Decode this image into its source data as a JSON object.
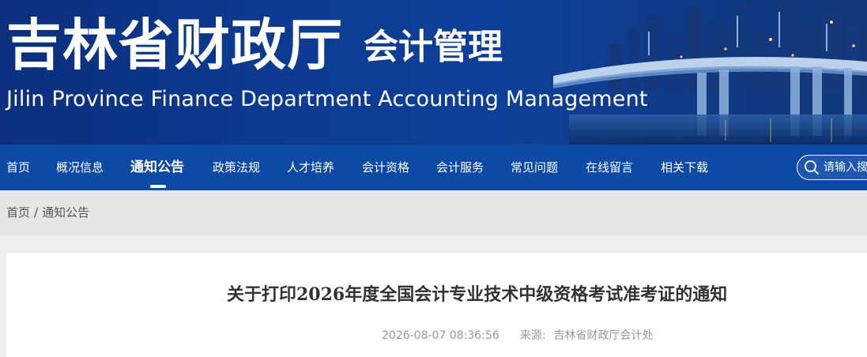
{
  "banner": {
    "title": "吉林省财政厅",
    "subtitle": "会计管理",
    "english": "Jilin Province Finance Department Accounting Management"
  },
  "nav": {
    "items": [
      {
        "label": "首页",
        "active": false
      },
      {
        "label": "概况信息",
        "active": false
      },
      {
        "label": "通知公告",
        "active": true
      },
      {
        "label": "政策法规",
        "active": false
      },
      {
        "label": "人才培养",
        "active": false
      },
      {
        "label": "会计资格",
        "active": false
      },
      {
        "label": "会计服务",
        "active": false
      },
      {
        "label": "常见问题",
        "active": false
      },
      {
        "label": "在线留言",
        "active": false
      },
      {
        "label": "相关下载",
        "active": false
      }
    ],
    "search": {
      "placeholder": "请输入搜"
    }
  },
  "breadcrumb": {
    "home": "首页",
    "separator": "/",
    "current": "通知公告"
  },
  "article": {
    "title": "关于打印2026年度全国会计专业技术中级资格考试准考证的通知",
    "datetime": "2026-08-07 08:36:56",
    "source_label": "来源:",
    "source_value": "吉林省财政厅会计处"
  },
  "colors": {
    "banner_blue": "#0d3b93",
    "nav_blue": "#0c4aa6",
    "breadcrumb_bg": "#e6e6e6",
    "title_text": "#333333",
    "meta_text": "#999999"
  }
}
